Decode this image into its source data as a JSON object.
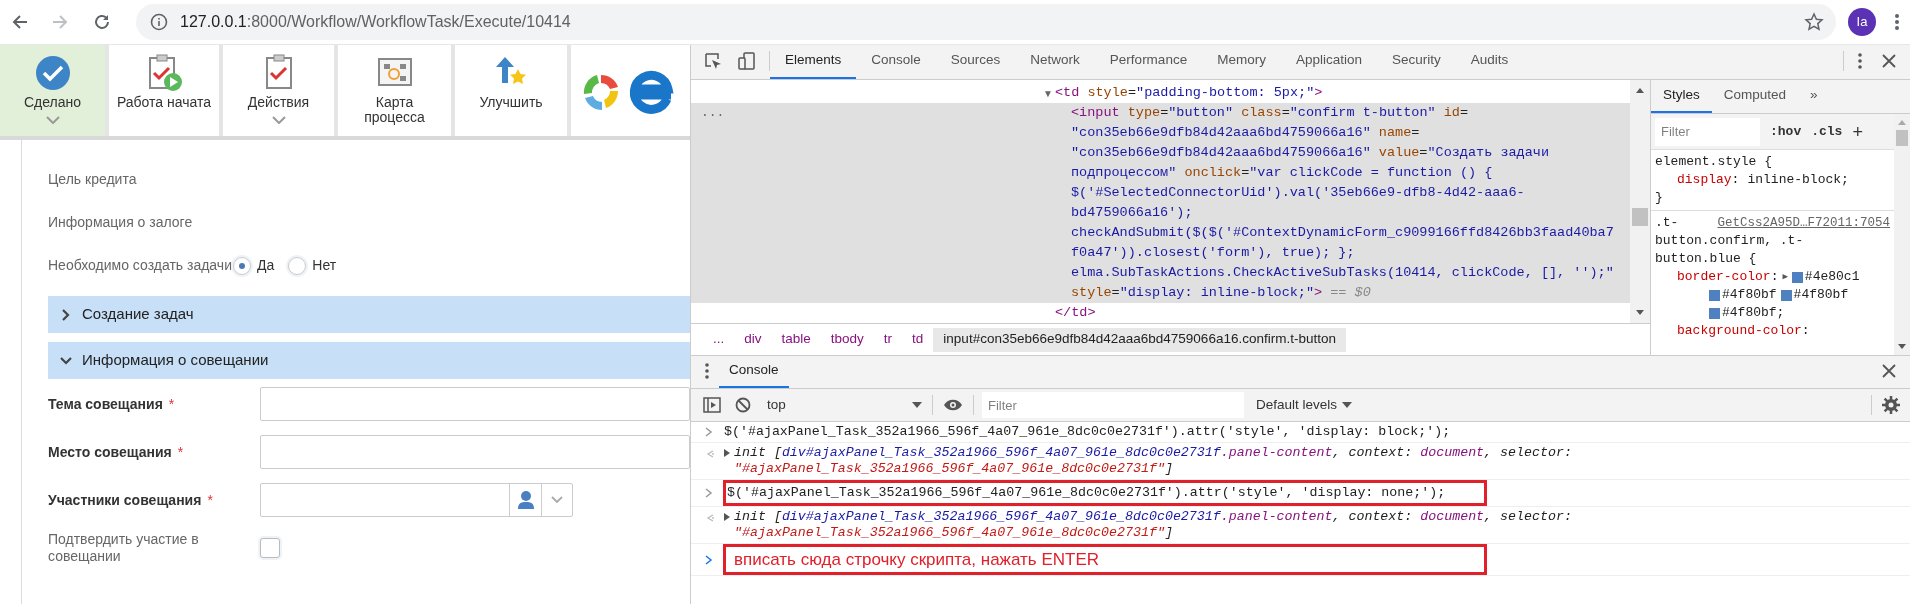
{
  "browser": {
    "url_host": "127.0.0.1",
    "url_path": ":8000/Workflow/WorkflowTask/Execute/10414",
    "profile": "Ia"
  },
  "toolbar": [
    {
      "label": "Сделано",
      "kind": "done",
      "selected": true,
      "dropdown": true
    },
    {
      "label": "Работа начата",
      "kind": "started",
      "selected": false,
      "dropdown": false
    },
    {
      "label": "Действия",
      "kind": "actions",
      "selected": false,
      "dropdown": true
    },
    {
      "label": "Карта\nпроцесса",
      "kind": "map",
      "selected": false,
      "dropdown": false
    },
    {
      "label": "Улучшить",
      "kind": "improve",
      "selected": false,
      "dropdown": false
    }
  ],
  "form": {
    "rows": [
      {
        "kind": "text",
        "label": "Цель кредита"
      },
      {
        "kind": "text",
        "label": "Информация о залоге"
      },
      {
        "kind": "radio",
        "label": "Необходимо создать задачи",
        "options": [
          {
            "label": "Да",
            "selected": true
          },
          {
            "label": "Нет",
            "selected": false
          }
        ]
      }
    ],
    "sections": [
      {
        "title": "Создание задач",
        "expanded": false
      },
      {
        "title": "Информация о совещании",
        "expanded": true,
        "fields": [
          {
            "kind": "input",
            "label": "Тема совещания",
            "required_mark": "*"
          },
          {
            "kind": "input",
            "label": "Место совещания",
            "required_mark": "*"
          },
          {
            "kind": "user",
            "label": "Участники совещания",
            "required_mark": "*"
          },
          {
            "kind": "checkbox",
            "label": "Подтвердить участие в совещании",
            "checked": false
          }
        ]
      }
    ]
  },
  "devtools": {
    "tabs": [
      {
        "label": "Elements",
        "selected": true
      },
      {
        "label": "Console",
        "selected": false
      },
      {
        "label": "Sources",
        "selected": false
      },
      {
        "label": "Network",
        "selected": false
      },
      {
        "label": "Performance",
        "selected": false
      },
      {
        "label": "Memory",
        "selected": false
      },
      {
        "label": "Application",
        "selected": false
      },
      {
        "label": "Security",
        "selected": false
      },
      {
        "label": "Audits",
        "selected": false
      }
    ],
    "dom": [
      {
        "caret": "▼",
        "selected": false,
        "tokens": [
          {
            "kind": "tag",
            "text": "<td"
          },
          {
            "kind": "attr",
            "text": " style"
          },
          {
            "kind": "plain",
            "text": "="
          },
          {
            "kind": "val",
            "text": "\"padding-bottom: 5px;\""
          },
          {
            "kind": "tag",
            "text": ">"
          }
        ],
        "children": [
          {
            "selected": true,
            "gutter": "...",
            "lines": [
              [
                {
                  "kind": "tag",
                  "text": "<input"
                },
                {
                  "kind": "attr",
                  "text": " type"
                },
                {
                  "kind": "plain",
                  "text": "="
                },
                {
                  "kind": "val",
                  "text": "\"button\""
                },
                {
                  "kind": "attr",
                  "text": " class"
                },
                {
                  "kind": "plain",
                  "text": "="
                },
                {
                  "kind": "val",
                  "text": "\"confirm t-button\""
                },
                {
                  "kind": "attr",
                  "text": " id"
                },
                {
                  "kind": "plain",
                  "text": "="
                }
              ],
              [
                {
                  "kind": "val",
                  "text": "\"con35eb66e9dfb84d42aaa6bd4759066a16\""
                },
                {
                  "kind": "attr",
                  "text": " name"
                },
                {
                  "kind": "plain",
                  "text": "="
                }
              ],
              [
                {
                  "kind": "val",
                  "text": "\"con35eb66e9dfb84d42aaa6bd4759066a16\""
                },
                {
                  "kind": "attr",
                  "text": " value"
                },
                {
                  "kind": "plain",
                  "text": "="
                },
                {
                  "kind": "val",
                  "text": "\"Создать задачи"
                }
              ],
              [
                {
                  "kind": "val",
                  "text": "подпроцессом\""
                },
                {
                  "kind": "attr",
                  "text": " onclick"
                },
                {
                  "kind": "plain",
                  "text": "="
                },
                {
                  "kind": "val",
                  "text": "\"var clickCode = function () {"
                }
              ],
              [
                {
                  "kind": "val",
                  "text": "$('#SelectedConnectorUid').val('35eb66e9-dfb8-4d42-aaa6-"
                }
              ],
              [
                {
                  "kind": "val",
                  "text": "bd4759066a16');"
                }
              ],
              [
                {
                  "kind": "val",
                  "text": "checkAndSubmit($($('#ContextDynamicForm_c9099166ffd8426bb3faad40ba7"
                }
              ],
              [
                {
                  "kind": "val",
                  "text": "f0a47')).closest('form'), true); };"
                }
              ],
              [
                {
                  "kind": "val",
                  "text": "elma.SubTaskActions.CheckActiveSubTasks(10414, clickCode, [], '');\""
                }
              ],
              [
                {
                  "kind": "attr",
                  "text": "style"
                },
                {
                  "kind": "plain",
                  "text": "="
                },
                {
                  "kind": "val",
                  "text": "\"display: inline-block;\""
                },
                {
                  "kind": "tag",
                  "text": ">"
                },
                {
                  "kind": "note",
                  "text": " == $0"
                }
              ]
            ]
          }
        ],
        "closing": [
          {
            "kind": "tag",
            "text": "</td>"
          }
        ]
      }
    ],
    "breadcrumbs": [
      {
        "label": "...",
        "selected": false
      },
      {
        "label": "div",
        "selected": false
      },
      {
        "label": "table",
        "selected": false
      },
      {
        "label": "tbody",
        "selected": false
      },
      {
        "label": "tr",
        "selected": false
      },
      {
        "label": "td",
        "selected": false
      },
      {
        "label": "input#con35eb66e9dfb84d42aaa6bd4759066a16.confirm.t-button",
        "selected": true
      }
    ],
    "styles": {
      "tabs": [
        {
          "label": "Styles",
          "selected": true
        },
        {
          "label": "Computed",
          "selected": false
        },
        {
          "label": "»",
          "selected": false
        }
      ],
      "filter_placeholder": "Filter",
      "hov": ":hov",
      "cls": ".cls",
      "add": "+",
      "rules": [
        {
          "selector_lines": [
            "element.style {"
          ],
          "props": [
            {
              "name": "display",
              "sep": ":",
              "value": "inline-block;"
            }
          ],
          "close": "}"
        },
        {
          "selector_lines": [
            ".t-",
            "button.confirm, .t-",
            "button.blue {"
          ],
          "source": "GetCss2A95D…F72011:7054",
          "props": [
            {
              "name": "border-color",
              "sep": ":",
              "expander": "▶",
              "swatch_lines": [
                [
                  {
                    "text": "#4e80c1",
                    "color": "#4e80c1"
                  }
                ],
                [
                  {
                    "text": "#4f80bf",
                    "color": "#4f80bf"
                  },
                  {
                    "text": "#4f80bf",
                    "color": "#4f80bf"
                  }
                ],
                [
                  {
                    "text": "#4f80bf;",
                    "color": "#4f80bf"
                  }
                ]
              ]
            },
            {
              "name": "background-color",
              "sep": ":"
            }
          ]
        }
      ]
    }
  },
  "console": {
    "tab": "Console",
    "context": "top",
    "filter_placeholder": "Filter",
    "levels": "Default levels",
    "messages": [
      {
        "kind": "input",
        "highlighted": false,
        "text": "$('#ajaxPanel_Task_352a1966_596f_4a07_961e_8dc0c0e2731f').attr('style', 'display: block;');"
      },
      {
        "kind": "result",
        "lines": [
          [
            {
              "kind": "i_plain",
              "text": "init ["
            },
            {
              "kind": "i_node",
              "text": "div#ajaxPanel_Task_352a1966_596f_4a07_961e_8dc0c0e2731f"
            },
            {
              "kind": "i_class",
              "text": ".panel-content"
            },
            {
              "kind": "i_plain",
              "text": ", context: "
            },
            {
              "kind": "i_class",
              "text": "document"
            },
            {
              "kind": "i_plain",
              "text": ", selector: "
            }
          ],
          [
            {
              "kind": "i_str",
              "text": "\"#ajaxPanel_Task_352a1966_596f_4a07_961e_8dc0c0e2731f\""
            },
            {
              "kind": "i_plain",
              "text": "]"
            }
          ]
        ]
      },
      {
        "kind": "input",
        "highlighted": true,
        "text": "$('#ajaxPanel_Task_352a1966_596f_4a07_961e_8dc0c0e2731f').attr('style', 'display: none;');"
      },
      {
        "kind": "result",
        "lines": [
          [
            {
              "kind": "i_plain",
              "text": "init ["
            },
            {
              "kind": "i_node",
              "text": "div#ajaxPanel_Task_352a1966_596f_4a07_961e_8dc0c0e2731f"
            },
            {
              "kind": "i_class",
              "text": ".panel-content"
            },
            {
              "kind": "i_plain",
              "text": ", context: "
            },
            {
              "kind": "i_class",
              "text": "document"
            },
            {
              "kind": "i_plain",
              "text": ", selector: "
            }
          ],
          [
            {
              "kind": "i_str",
              "text": "\"#ajaxPanel_Task_352a1966_596f_4a07_961e_8dc0c0e2731f\""
            },
            {
              "kind": "i_plain",
              "text": "]"
            }
          ]
        ]
      },
      {
        "kind": "prompt",
        "highlighted": true,
        "text": "вписать сюда строчку скрипта, нажать ENTER"
      }
    ]
  }
}
